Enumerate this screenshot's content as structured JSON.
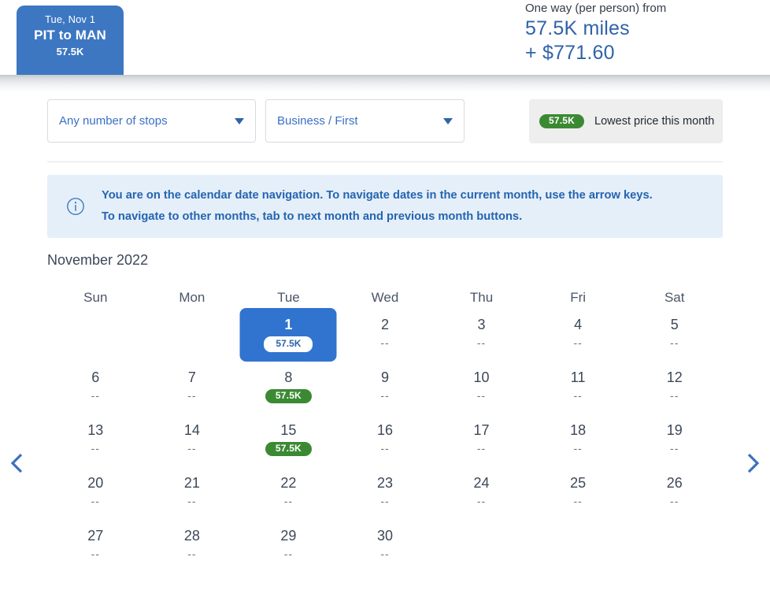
{
  "header": {
    "flight_card": {
      "date": "Tue, Nov 1",
      "route": "PIT to MAN",
      "miles": "57.5K"
    },
    "price": {
      "label": "One way (per person) from",
      "miles": "57.5K miles",
      "cash": "+ $771.60"
    }
  },
  "filters": {
    "stops": {
      "value": "Any number of stops",
      "caret_icon": "chevron-down-icon"
    },
    "cabin": {
      "value": "Business / First",
      "caret_icon": "chevron-down-icon"
    },
    "legend": {
      "badge": "57.5K",
      "text": "Lowest price this month",
      "badge_color": "#3b8a33"
    }
  },
  "info_banner": {
    "icon": "info-circle-icon",
    "text": "You are on the calendar date navigation. To navigate dates in the current month, use the arrow keys. To navigate to other months, tab to next month and previous month buttons.",
    "accent_color": "#2564b0",
    "background_color": "#e5eff9"
  },
  "calendar": {
    "month_title": "November 2022",
    "weekday_headers": [
      "Sun",
      "Mon",
      "Tue",
      "Wed",
      "Thu",
      "Fri",
      "Sat"
    ],
    "selected_color": "#3174cf",
    "lowest_price_color": "#3b8a33",
    "no_price_placeholder": "--",
    "weeks": [
      [
        {
          "day": "",
          "price": "",
          "state": "empty"
        },
        {
          "day": "",
          "price": "",
          "state": "empty"
        },
        {
          "day": "1",
          "price": "57.5K",
          "state": "selected"
        },
        {
          "day": "2",
          "price": "--",
          "state": "normal"
        },
        {
          "day": "3",
          "price": "--",
          "state": "normal"
        },
        {
          "day": "4",
          "price": "--",
          "state": "normal"
        },
        {
          "day": "5",
          "price": "--",
          "state": "normal"
        }
      ],
      [
        {
          "day": "6",
          "price": "--",
          "state": "normal"
        },
        {
          "day": "7",
          "price": "--",
          "state": "normal"
        },
        {
          "day": "8",
          "price": "57.5K",
          "state": "lowest"
        },
        {
          "day": "9",
          "price": "--",
          "state": "normal"
        },
        {
          "day": "10",
          "price": "--",
          "state": "normal"
        },
        {
          "day": "11",
          "price": "--",
          "state": "normal"
        },
        {
          "day": "12",
          "price": "--",
          "state": "normal"
        }
      ],
      [
        {
          "day": "13",
          "price": "--",
          "state": "normal"
        },
        {
          "day": "14",
          "price": "--",
          "state": "normal"
        },
        {
          "day": "15",
          "price": "57.5K",
          "state": "lowest"
        },
        {
          "day": "16",
          "price": "--",
          "state": "normal"
        },
        {
          "day": "17",
          "price": "--",
          "state": "normal"
        },
        {
          "day": "18",
          "price": "--",
          "state": "normal"
        },
        {
          "day": "19",
          "price": "--",
          "state": "normal"
        }
      ],
      [
        {
          "day": "20",
          "price": "--",
          "state": "normal"
        },
        {
          "day": "21",
          "price": "--",
          "state": "normal"
        },
        {
          "day": "22",
          "price": "--",
          "state": "normal"
        },
        {
          "day": "23",
          "price": "--",
          "state": "normal"
        },
        {
          "day": "24",
          "price": "--",
          "state": "normal"
        },
        {
          "day": "25",
          "price": "--",
          "state": "normal"
        },
        {
          "day": "26",
          "price": "--",
          "state": "normal"
        }
      ],
      [
        {
          "day": "27",
          "price": "--",
          "state": "normal"
        },
        {
          "day": "28",
          "price": "--",
          "state": "normal"
        },
        {
          "day": "29",
          "price": "--",
          "state": "normal"
        },
        {
          "day": "30",
          "price": "--",
          "state": "normal"
        },
        {
          "day": "",
          "price": "",
          "state": "empty"
        },
        {
          "day": "",
          "price": "",
          "state": "empty"
        },
        {
          "day": "",
          "price": "",
          "state": "empty"
        }
      ]
    ],
    "prev_month_icon": "chevron-left-icon",
    "next_month_icon": "chevron-right-icon"
  }
}
